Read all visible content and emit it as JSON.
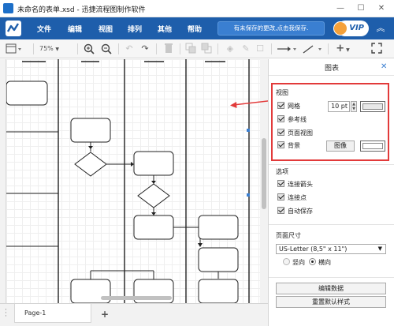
{
  "window": {
    "title": "未命名的表单.xsd - 迅捷流程图制作软件",
    "minimize": "—",
    "maximize": "☐",
    "close": "✕"
  },
  "menubar": {
    "items": [
      "文件",
      "编辑",
      "视图",
      "排列",
      "其他",
      "帮助"
    ],
    "unsaved_notice": "有未保存的更改,点击我保存.",
    "vip_label": "VIP",
    "collapse": "︽"
  },
  "toolbar": {
    "zoom": "75%"
  },
  "colors": {
    "menubar_bg": "#1e5eab",
    "highlight_box": "#e23a3a",
    "arrow": "#e23a3a"
  },
  "tabs": {
    "page_label": "Page-1",
    "add": "+"
  },
  "panel": {
    "title": "图表",
    "close": "✕",
    "view_section": {
      "title": "视图",
      "grid_label": "网格",
      "grid_size": "10 pt",
      "guides_label": "参考线",
      "page_view_label": "页面视图",
      "background_label": "背景",
      "image_button": "图像",
      "grid_checked": true,
      "guides_checked": true,
      "page_view_checked": true,
      "background_checked": true
    },
    "options_section": {
      "title": "选项",
      "connect_arrows": "连接箭头",
      "connect_points": "连接点",
      "autosave": "自动保存"
    },
    "page_size_section": {
      "title": "页面尺寸",
      "selected": "US-Letter (8,5\" x 11\")",
      "portrait": "竖向",
      "landscape": "横向",
      "orientation": "landscape"
    },
    "buttons": {
      "edit_data": "编辑数据",
      "reset_style": "重置默认样式"
    }
  }
}
